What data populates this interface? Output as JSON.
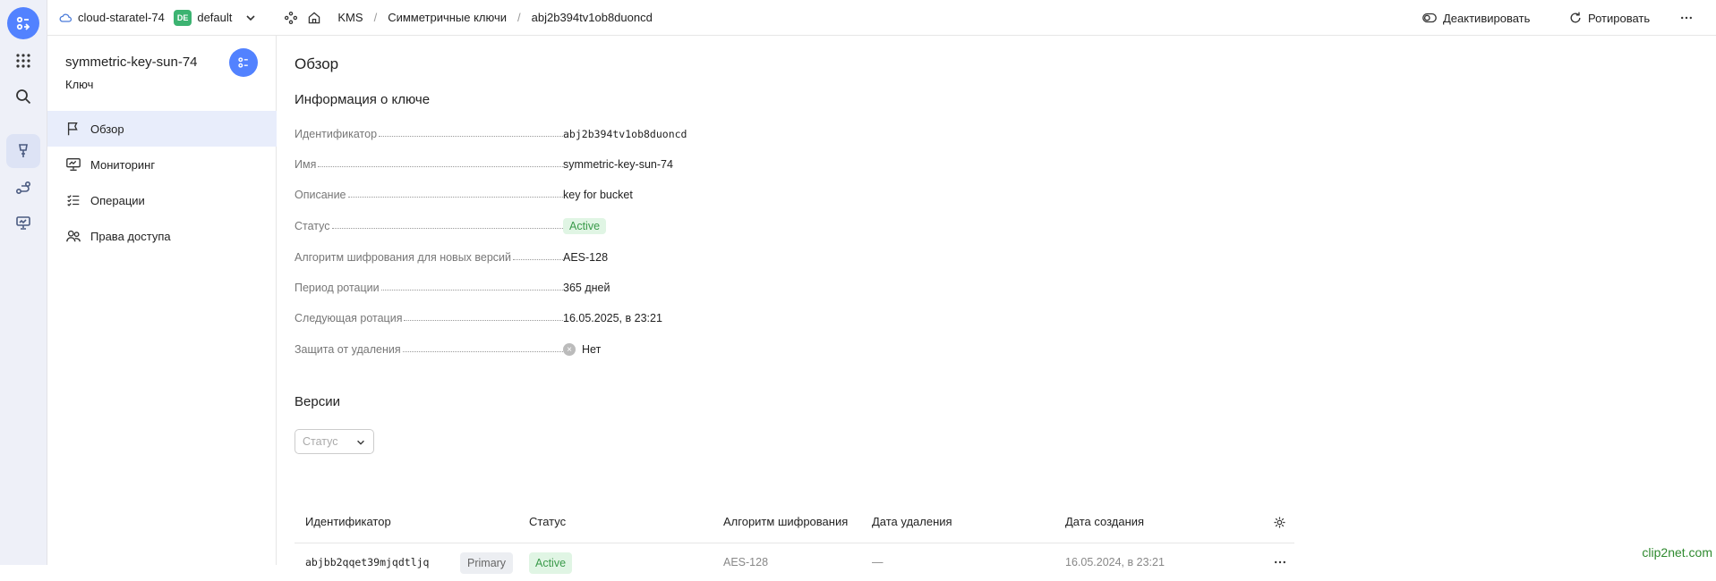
{
  "topbar": {
    "cloud": "cloud-staratel-74",
    "folder_badge": "DE",
    "folder": "default",
    "breadcrumbs": [
      "KMS",
      "Симметричные ключи",
      "abj2b394tv1ob8duoncd"
    ],
    "deactivate_label": "Деактивировать",
    "rotate_label": "Ротировать"
  },
  "sidebar": {
    "title": "symmetric-key-sun-74",
    "subtitle": "Ключ",
    "items": [
      {
        "label": "Обзор",
        "icon": "flag-icon"
      },
      {
        "label": "Мониторинг",
        "icon": "monitor-icon"
      },
      {
        "label": "Операции",
        "icon": "list-check-icon"
      },
      {
        "label": "Права доступа",
        "icon": "people-icon"
      }
    ]
  },
  "main": {
    "title": "Обзор",
    "info_title": "Информация о ключе",
    "info": [
      {
        "key": "Идентификатор",
        "value": "abj2b394tv1ob8duoncd"
      },
      {
        "key": "Имя",
        "value": "symmetric-key-sun-74"
      },
      {
        "key": "Описание",
        "value": "key for bucket"
      },
      {
        "key": "Статус",
        "value": "Active"
      },
      {
        "key": "Алгоритм шифрования для новых версий",
        "value": "AES-128"
      },
      {
        "key": "Период ротации",
        "value": "365 дней"
      },
      {
        "key": "Следующая ротация",
        "value": "16.05.2025, в 23:21"
      },
      {
        "key": "Защита от удаления",
        "value": "Нет"
      }
    ],
    "versions_title": "Версии",
    "filter_placeholder": "Статус",
    "table": {
      "headers": [
        "Идентификатор",
        "Статус",
        "Алгоритм шифрования",
        "Дата удаления",
        "Дата создания"
      ],
      "rows": [
        {
          "id": "abjbb2qqet39mjqdtljq",
          "tag": "Primary",
          "status": "Active",
          "algorithm": "AES-128",
          "deleted": "—",
          "created": "16.05.2024, в 23:21"
        }
      ]
    }
  },
  "watermark": "clip2net.com",
  "colors": {
    "accent": "#5282ff",
    "active_bg": "#e0f5e4",
    "active_text": "#3a9a4a",
    "folder_badge": "#3cb371"
  }
}
